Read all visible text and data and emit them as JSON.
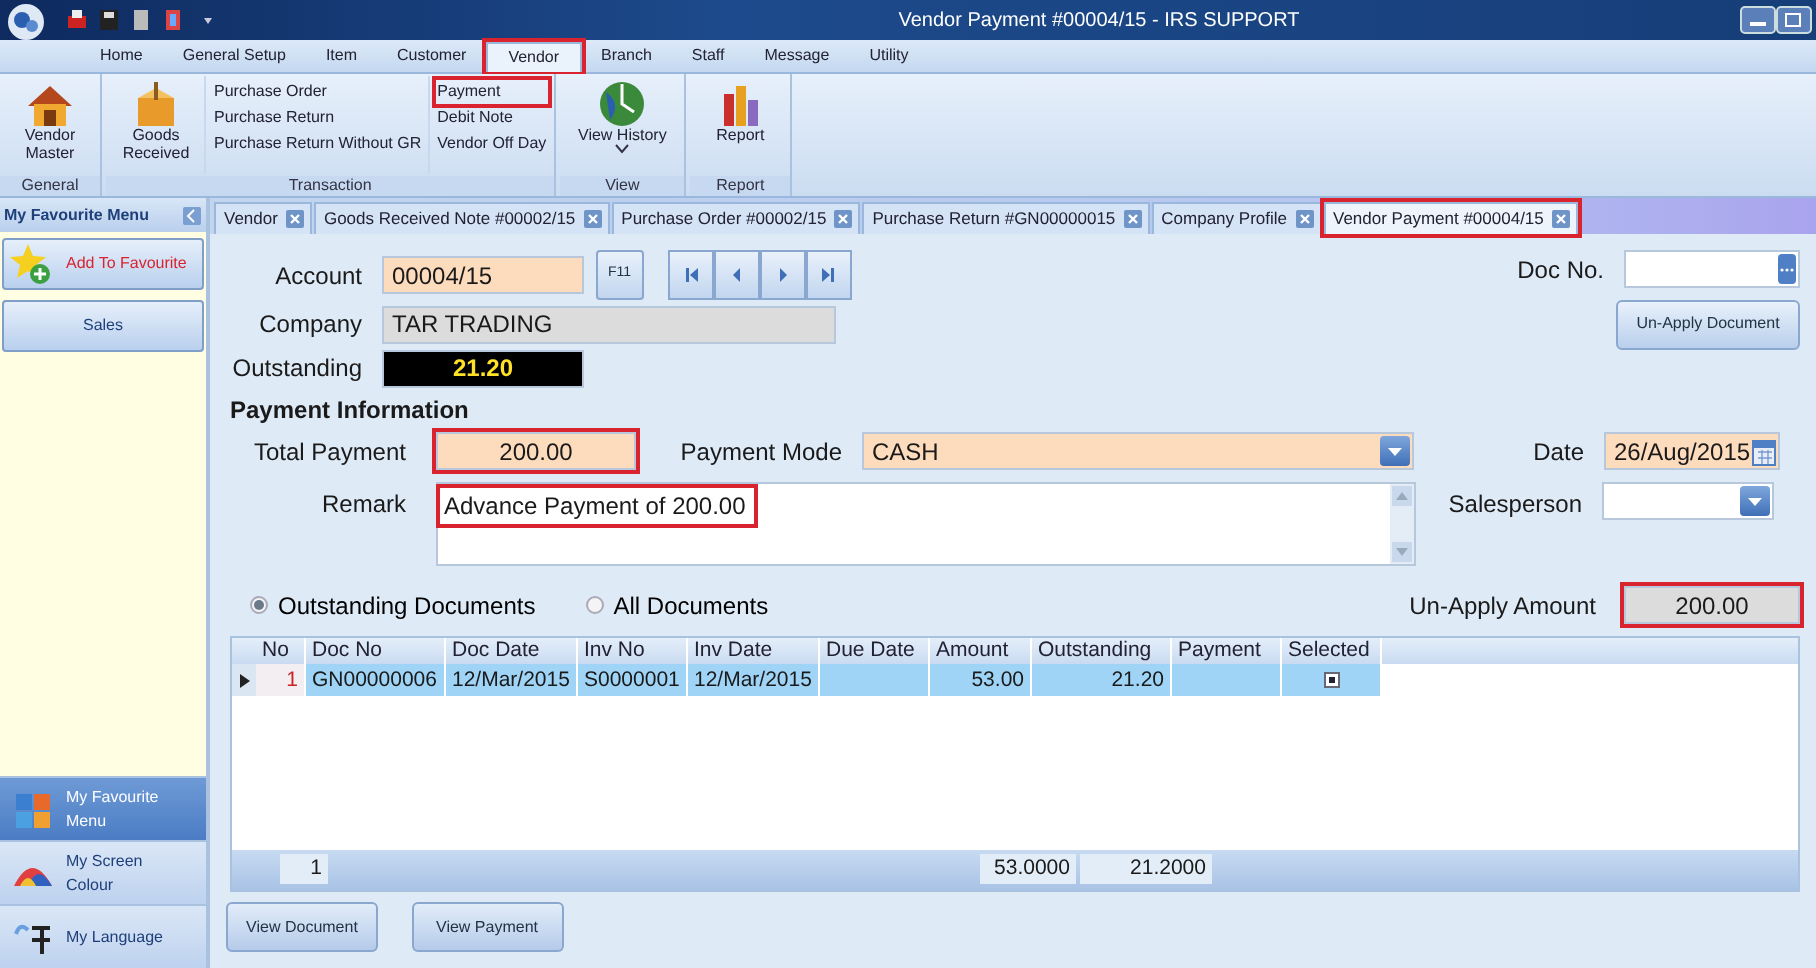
{
  "window": {
    "title": "Vendor Payment #00004/15 - IRS SUPPORT"
  },
  "ribbon_tabs": [
    {
      "label": "Home",
      "selected": false,
      "highlighted": false
    },
    {
      "label": "General Setup",
      "selected": false,
      "highlighted": false
    },
    {
      "label": "Item",
      "selected": false,
      "highlighted": false
    },
    {
      "label": "Customer",
      "selected": false,
      "highlighted": false
    },
    {
      "label": "Vendor",
      "selected": true,
      "highlighted": true
    },
    {
      "label": "Branch",
      "selected": false,
      "highlighted": false
    },
    {
      "label": "Staff",
      "selected": false,
      "highlighted": false
    },
    {
      "label": "Message",
      "selected": false,
      "highlighted": false
    },
    {
      "label": "Utility",
      "selected": false,
      "highlighted": false
    }
  ],
  "ribbon_groups": [
    {
      "label": "General",
      "items": [
        {
          "kind": "large",
          "label": "Vendor Master"
        }
      ]
    },
    {
      "label": "Transaction",
      "items": [
        {
          "kind": "large",
          "label": "Goods Received"
        },
        {
          "kind": "column",
          "items": [
            {
              "label": "Purchase Order",
              "highlighted": false
            },
            {
              "label": "Purchase Return",
              "highlighted": false
            },
            {
              "label": "Purchase Return Without GR",
              "highlighted": false
            }
          ]
        },
        {
          "kind": "column",
          "items": [
            {
              "label": "Payment",
              "highlighted": true
            },
            {
              "label": "Debit Note",
              "highlighted": false
            },
            {
              "label": "Vendor Off Day",
              "highlighted": false
            }
          ]
        }
      ]
    },
    {
      "label": "View",
      "items": [
        {
          "kind": "large",
          "label": "View History",
          "dropdown": true
        }
      ]
    },
    {
      "label": "Report",
      "items": [
        {
          "kind": "large",
          "label": "Report"
        }
      ]
    }
  ],
  "sidebar": {
    "title": "My Favourite Menu",
    "items": [
      {
        "kind": "add",
        "label": "Add To Favourite"
      },
      {
        "kind": "plain",
        "label": "Sales"
      }
    ],
    "bottom_items": [
      {
        "label": "My Favourite Menu",
        "selected": true
      },
      {
        "label": "My Screen Colour",
        "selected": false
      },
      {
        "label": "My Language",
        "selected": false
      }
    ]
  },
  "doc_tabs": [
    {
      "label": "Vendor",
      "selected": false,
      "highlighted": false
    },
    {
      "label": "Goods Received Note #00002/15",
      "selected": false,
      "highlighted": false
    },
    {
      "label": "Purchase Order #00002/15",
      "selected": false,
      "highlighted": false
    },
    {
      "label": "Purchase Return #GN00000015",
      "selected": false,
      "highlighted": false
    },
    {
      "label": "Company Profile",
      "selected": false,
      "highlighted": false
    },
    {
      "label": "Vendor Payment #00004/15",
      "selected": true,
      "highlighted": true
    }
  ],
  "header": {
    "account_label": "Account",
    "account": "00004/15",
    "f11": "F11",
    "company_label": "Company",
    "company": "TAR TRADING",
    "outstanding_label": "Outstanding",
    "outstanding": "21.20",
    "doc_no_label": "Doc No.",
    "unapply_button": "Un-Apply Document"
  },
  "payment_info": {
    "title": "Payment Information",
    "total_payment_label": "Total Payment",
    "total_payment": "200.00",
    "total_payment_highlighted": true,
    "payment_mode_label": "Payment Mode",
    "payment_mode": "CASH",
    "date_label": "Date",
    "date": "26/Aug/2015",
    "remark_label": "Remark",
    "remark": "Advance Payment of 200.00",
    "remark_highlighted": true,
    "salesperson_label": "Salesperson"
  },
  "document_filter": [
    {
      "label": "Outstanding Documents",
      "selected": true
    },
    {
      "label": "All Documents",
      "selected": false
    }
  ],
  "unapply_amount": {
    "label": "Un-Apply Amount",
    "value": "200.00",
    "highlighted": true
  },
  "table": {
    "columns": [
      "No",
      "Doc No",
      "Doc Date",
      "Inv No",
      "Inv Date",
      "Due Date",
      "Amount",
      "Outstanding",
      "Payment",
      "Selected"
    ],
    "rows": [
      {
        "cells": [
          "1",
          "GN00000006",
          "12/Mar/2015",
          "S0000001",
          "12/Mar/2015",
          "",
          "53.00",
          "21.20",
          ""
        ],
        "selected": true,
        "current": true
      }
    ],
    "footer": {
      "count": "1",
      "amount": "53.0000",
      "outstanding": "21.2000"
    }
  },
  "buttons": [
    "View Document",
    "View Payment"
  ]
}
